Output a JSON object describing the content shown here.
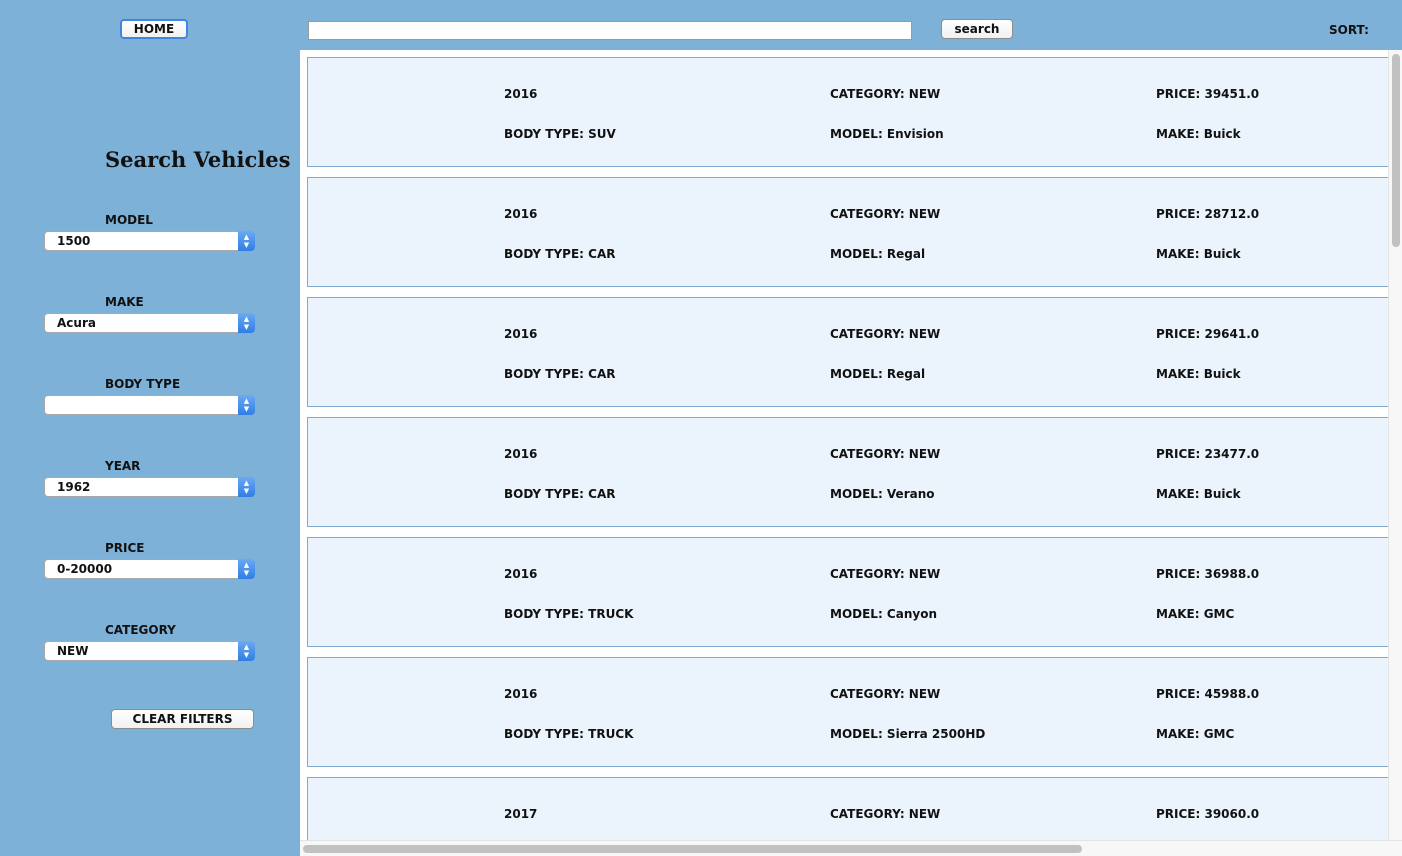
{
  "header": {
    "home_label": "HOME",
    "search_value": "",
    "search_button_label": "search",
    "sort_label": "SORT:"
  },
  "sidebar": {
    "title": "Search Vehicles",
    "filters": [
      {
        "label": "MODEL",
        "value": "1500"
      },
      {
        "label": "MAKE",
        "value": "Acura"
      },
      {
        "label": "BODY TYPE",
        "value": ""
      },
      {
        "label": "YEAR",
        "value": "1962"
      },
      {
        "label": "PRICE",
        "value": "0-20000"
      },
      {
        "label": "CATEGORY",
        "value": "NEW"
      }
    ],
    "clear_label": "CLEAR FILTERS"
  },
  "results": [
    {
      "year": "2016",
      "category": "CATEGORY: NEW",
      "price": "PRICE: 39451.0",
      "body_type": "BODY TYPE: SUV",
      "model": "MODEL: Envision",
      "make": "MAKE: Buick"
    },
    {
      "year": "2016",
      "category": "CATEGORY: NEW",
      "price": "PRICE: 28712.0",
      "body_type": "BODY TYPE: CAR",
      "model": "MODEL: Regal",
      "make": "MAKE: Buick"
    },
    {
      "year": "2016",
      "category": "CATEGORY: NEW",
      "price": "PRICE: 29641.0",
      "body_type": "BODY TYPE: CAR",
      "model": "MODEL: Regal",
      "make": "MAKE: Buick"
    },
    {
      "year": "2016",
      "category": "CATEGORY: NEW",
      "price": "PRICE: 23477.0",
      "body_type": "BODY TYPE: CAR",
      "model": "MODEL: Verano",
      "make": "MAKE: Buick"
    },
    {
      "year": "2016",
      "category": "CATEGORY: NEW",
      "price": "PRICE: 36988.0",
      "body_type": "BODY TYPE: TRUCK",
      "model": "MODEL: Canyon",
      "make": "MAKE: GMC"
    },
    {
      "year": "2016",
      "category": "CATEGORY: NEW",
      "price": "PRICE: 45988.0",
      "body_type": "BODY TYPE: TRUCK",
      "model": "MODEL: Sierra 2500HD",
      "make": "MAKE: GMC"
    },
    {
      "year": "2017",
      "category": "CATEGORY: NEW",
      "price": "PRICE: 39060.0",
      "body_type": "",
      "model": "",
      "make": ""
    }
  ]
}
